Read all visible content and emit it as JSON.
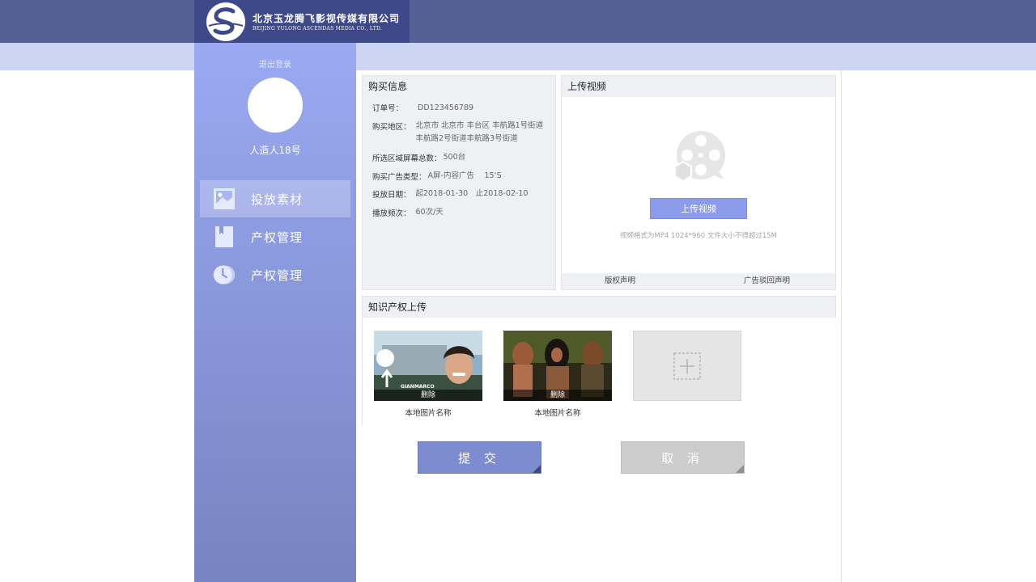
{
  "header": {
    "company_cn": "北京玉龙腾飞影视传媒有限公司",
    "company_en": "BEIJING YULONG ASCENDAS MEDIA CO., LTD.",
    "brand_color": "#3e4989"
  },
  "sidebar": {
    "logout": "退出登录",
    "username": "人造人18号",
    "items": [
      {
        "label": "投放素材",
        "icon": "image-icon",
        "active": true
      },
      {
        "label": "产权管理",
        "icon": "book-icon",
        "active": false
      },
      {
        "label": "产权管理",
        "icon": "clock-icon",
        "active": false
      }
    ]
  },
  "purchase": {
    "title": "购买信息",
    "order_label": "订单号：",
    "order_value": "DD123456789",
    "region_label": "购买地区：",
    "region_line1": "北京市 北京市 丰台区 丰航路1号街道",
    "region_line2": "丰航路2号街道丰航路3号街道",
    "screens_label": "所选区域屏幕总数：",
    "screens_value": "500台",
    "adtype_label": "购买广告类型：",
    "adtype_value": "A屏-内容广告　 15‘S",
    "date_label": "投放日期：",
    "date_value": "起2018-01-30　止2018-02-10",
    "freq_label": "播放频次：",
    "freq_value": "60次/天"
  },
  "upload": {
    "title": "上传视频",
    "button": "上传视频",
    "hint": "视频格式为MP4 1024*960 文件大小不得超过15M",
    "link_copyright": "版权声明",
    "link_ad": "广告驳回声明",
    "icon": "film-reel-icon"
  },
  "ip_upload": {
    "title": "知识产权上传",
    "items": [
      {
        "delete": "删除",
        "caption": "本地图片名称",
        "overlay_text": "GIANMARCO"
      },
      {
        "delete": "删除",
        "caption": "本地图片名称"
      }
    ]
  },
  "actions": {
    "submit": "提 交",
    "cancel": "取 消"
  }
}
